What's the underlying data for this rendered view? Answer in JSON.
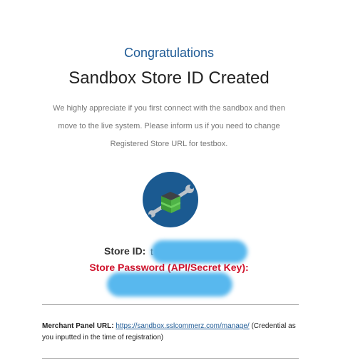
{
  "header": {
    "congrats": "Congratulations",
    "headline": "Sandbox Store ID Created"
  },
  "intro": {
    "text": "We highly appreciate if you first connect with the sandbox and then move to the live system. Please inform us if you need to change Registered Store URL for testbox."
  },
  "logo": {
    "icon": "box-wrench-icon",
    "bg_color": "#1b5a91",
    "box_color": "#4fb447"
  },
  "store": {
    "id_label": "Store ID:",
    "id_value": "t",
    "password_label": "Store Password (API/Secret Key):",
    "password_label_color": "#d0122b",
    "redaction_color": "#58b8ee"
  },
  "merchant": {
    "label": "Merchant Panel URL:",
    "url": "https://sandbox.sslcommerz.com/manage/",
    "note": "(Credential as you inputted in the time of registration)"
  }
}
